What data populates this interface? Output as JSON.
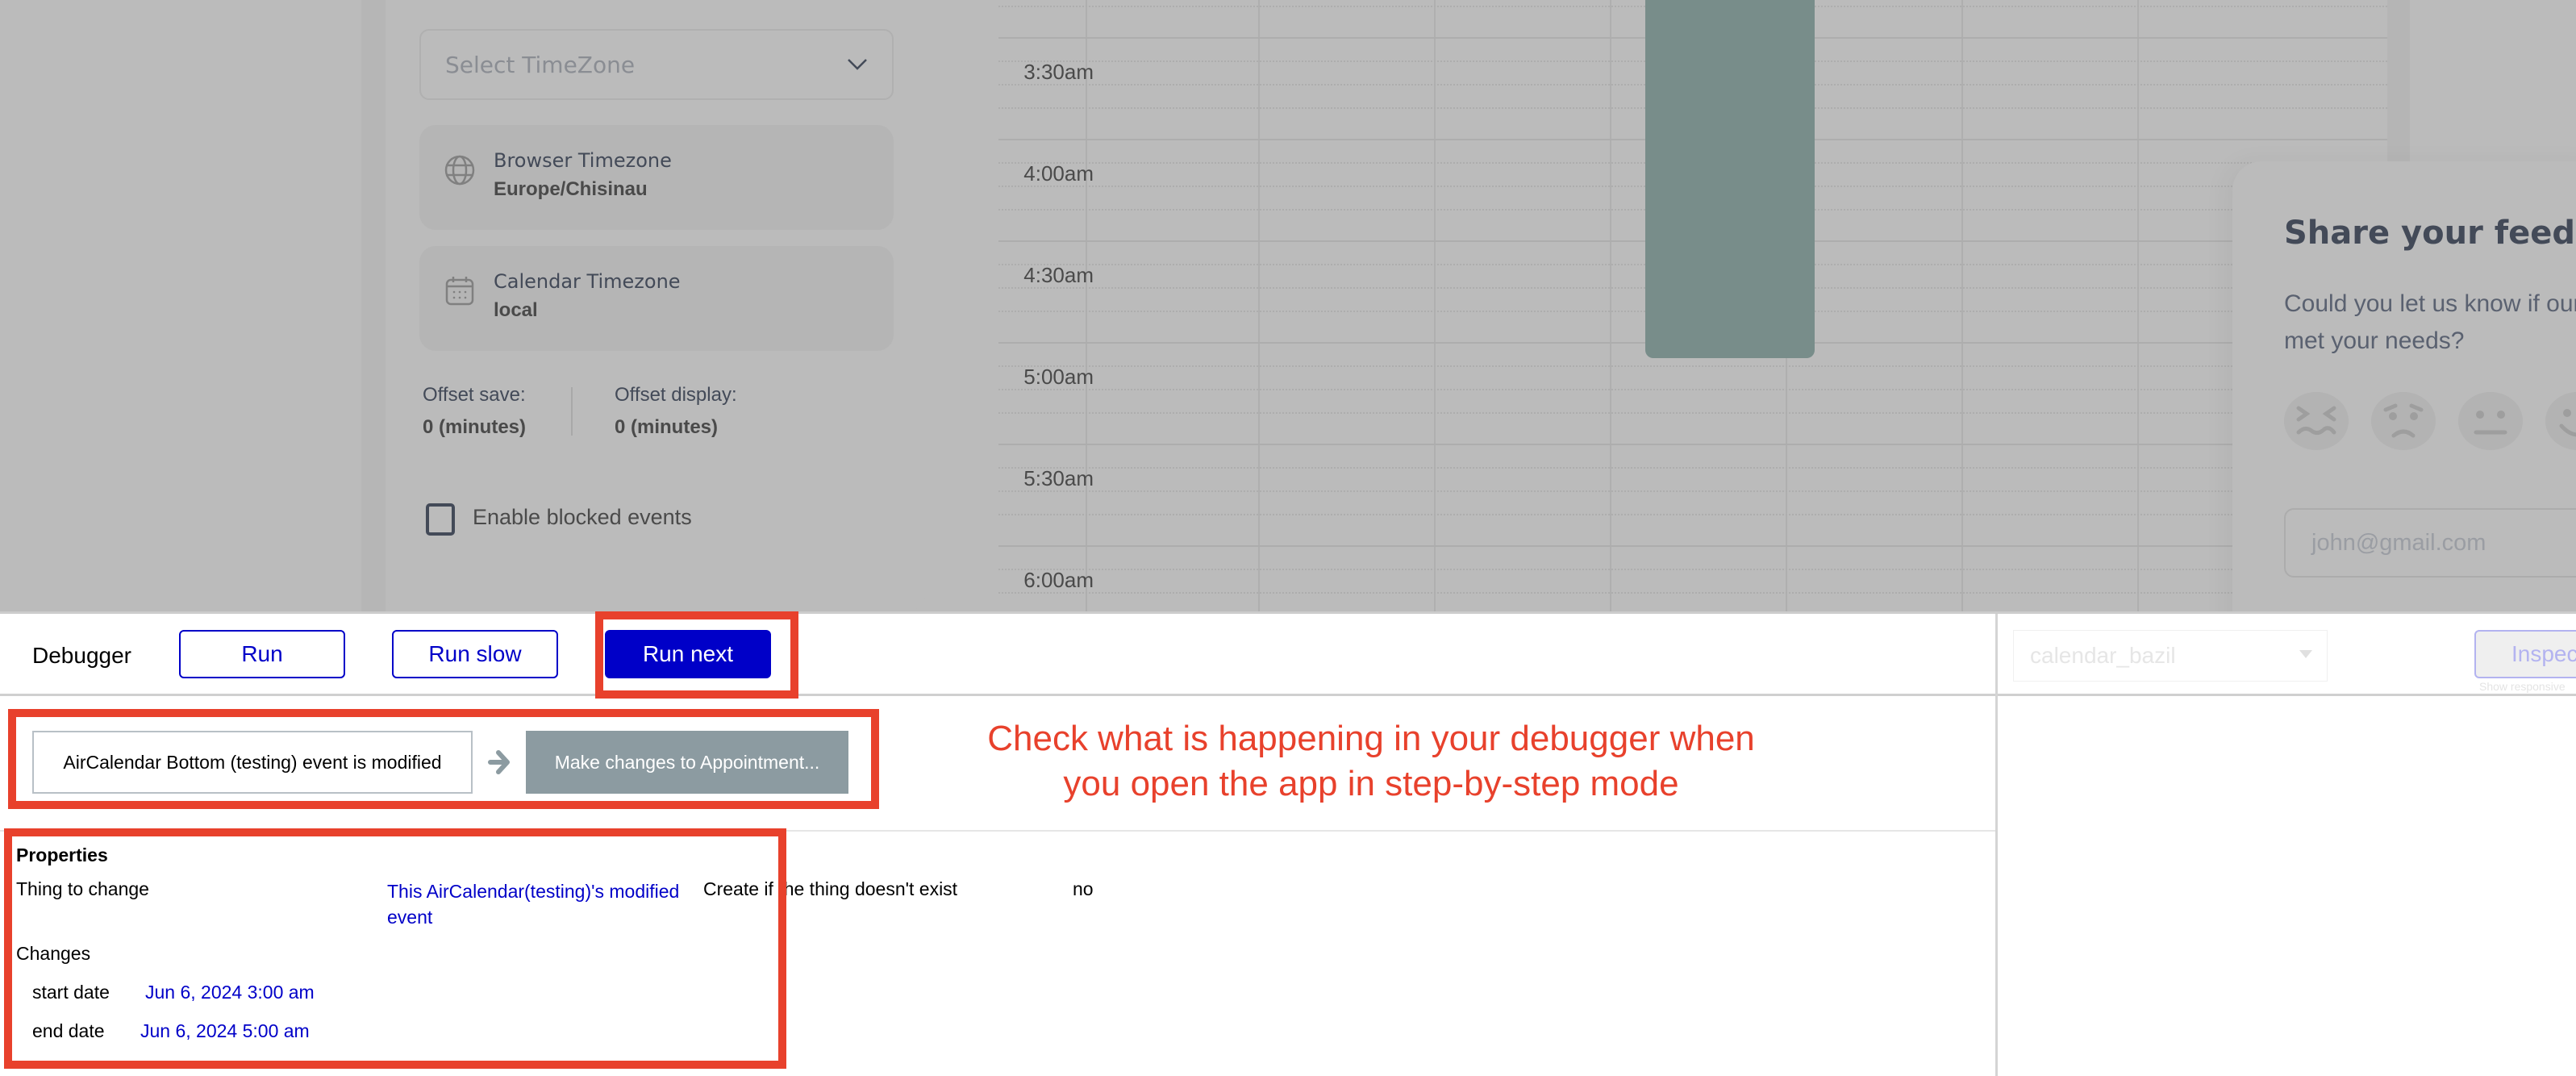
{
  "app": {
    "timezone_panel": {
      "select_placeholder": "Select TimeZone",
      "browser_timezone": {
        "icon": "globe-icon",
        "label": "Browser Timezone",
        "value": "Europe/Chisinau"
      },
      "calendar_timezone": {
        "icon": "calendar-icon",
        "label": "Calendar Timezone",
        "value": "local"
      },
      "offset_save": {
        "label": "Offset save:",
        "value": "0 (minutes)"
      },
      "offset_display": {
        "label": "Offset display:",
        "value": "0 (minutes)"
      },
      "enable_blocked_events": {
        "label": "Enable blocked events",
        "checked": false
      }
    },
    "calendar": {
      "time_labels": [
        "3:30am",
        "4:00am",
        "4:30am",
        "5:00am",
        "5:30am",
        "6:00am"
      ],
      "event_color": "#788d8a"
    },
    "feedback": {
      "title": "Share your feedback",
      "question": "Could you let us know if our app met your needs?",
      "emojis": [
        "very-dissatisfied-face-icon",
        "sad-face-icon",
        "neutral-face-icon",
        "happy-face-icon"
      ],
      "email_placeholder": "john@gmail.com"
    }
  },
  "debugger": {
    "title": "Debugger",
    "buttons": {
      "run": "Run",
      "run_slow": "Run slow",
      "run_next": "Run next",
      "inspect": "Inspect"
    },
    "app_select_value": "calendar_bazil",
    "responsive_link": "Show responsive",
    "step": {
      "event": "AirCalendar Bottom (testing) event is modified",
      "action": "Make changes to Appointment..."
    },
    "properties": {
      "title": "Properties",
      "thing_to_change_label": "Thing to change",
      "thing_to_change_value": "This AirCalendar(testing)'s modified event",
      "create_if_missing_label": "Create if the thing doesn't exist",
      "create_if_missing_value": "no",
      "changes_title": "Changes",
      "changes": [
        {
          "label": "start date",
          "value": "Jun 6, 2024 3:00 am"
        },
        {
          "label": "end date",
          "value": "Jun 6, 2024 5:00 am"
        }
      ]
    }
  },
  "annotation": {
    "hint": "Check what is happening in your debugger when you open the app in step-by-step mode",
    "color": "#e8412c"
  },
  "colors": {
    "primary_blue": "#0000c8",
    "overlay_gray": "#bbbbbb",
    "action_gray": "#8c9ba1"
  }
}
